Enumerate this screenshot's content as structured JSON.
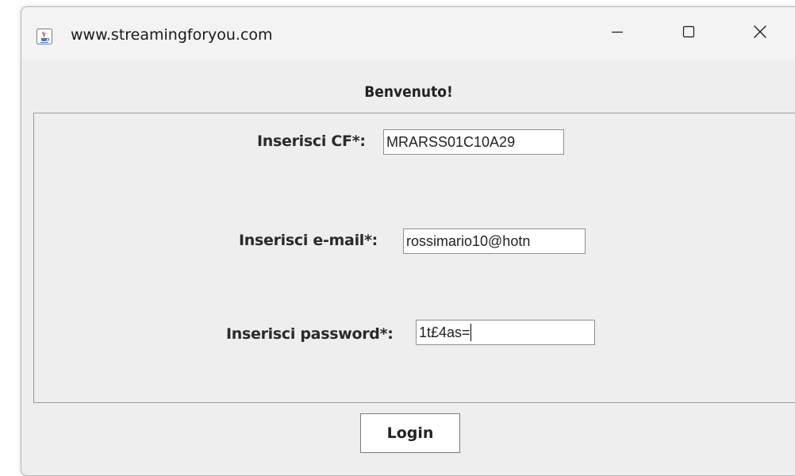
{
  "window": {
    "title": "www.streamingforyou.com",
    "app_icon": "java-cup-icon",
    "controls": {
      "minimize_icon": "minimize-icon",
      "maximize_icon": "maximize-icon",
      "close_icon": "close-icon"
    }
  },
  "form": {
    "heading": "Benvenuto!",
    "cf": {
      "label": "Inserisci CF*:",
      "value": "MRARSS01C10A29"
    },
    "email": {
      "label": "Inserisci e-mail*:",
      "value": "rossimario10@hotn"
    },
    "password": {
      "label": "Inserisci password*:",
      "value": "1t£4as="
    },
    "login_label": "Login"
  },
  "colors": {
    "window_bg": "#eeeeee",
    "titlebar_bg": "#f3f3f3",
    "field_bg": "#ffffff",
    "border": "#9a9a9a"
  }
}
